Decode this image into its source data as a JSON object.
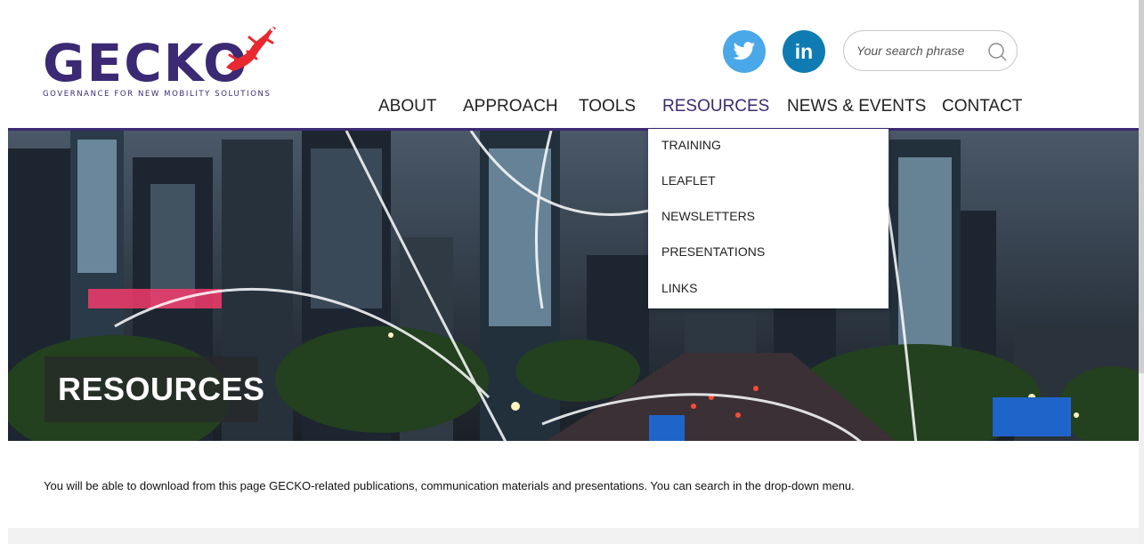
{
  "logo": {
    "wordmark": "GECKO",
    "tagline": "GOVERNANCE FOR NEW MOBILITY SOLUTIONS"
  },
  "social": [
    {
      "name": "twitter-icon",
      "label": ""
    },
    {
      "name": "linkedin-icon",
      "label": "in"
    }
  ],
  "search": {
    "placeholder": "Your search phrase",
    "value": ""
  },
  "nav": {
    "items": [
      {
        "label": "ABOUT"
      },
      {
        "label": "APPROACH"
      },
      {
        "label": "TOOLS"
      },
      {
        "label": "RESOURCES",
        "active": true
      },
      {
        "label": "NEWS & EVENTS"
      },
      {
        "label": "CONTACT"
      }
    ]
  },
  "dropdown": {
    "items": [
      {
        "label": "TRAINING"
      },
      {
        "label": "LEAFLET"
      },
      {
        "label": "NEWSLETTERS"
      },
      {
        "label": "PRESENTATIONS"
      },
      {
        "label": "LINKS"
      }
    ]
  },
  "hero": {
    "title": "RESOURCES"
  },
  "intro": "You will be able to download from this page GECKO-related publications, communication materials and presentations. You can search in the drop-down menu.",
  "colors": {
    "brand": "#3b2a73",
    "accent_red": "#e8292f",
    "twitter": "#4aa8e8",
    "linkedin": "#0f7bb2"
  }
}
